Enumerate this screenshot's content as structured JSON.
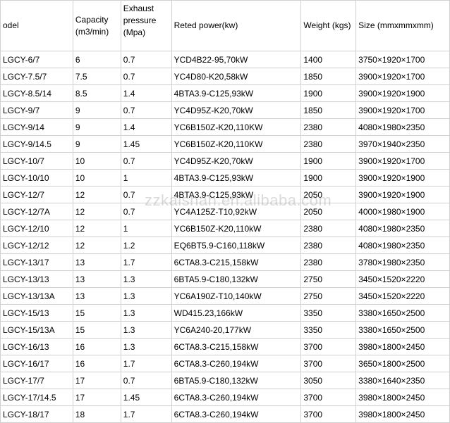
{
  "headers": {
    "model": "odel",
    "capacity": "Capacity (m3/min)",
    "exhaust": "Exhaust pressure (Mpa)",
    "power": "Reted power(kw)",
    "weight": "Weight (kgs)",
    "size": "Size (mmxmmxmm)"
  },
  "rows": [
    {
      "model": "LGCY-6/7",
      "capacity": "6",
      "exhaust": "0.7",
      "power": "YCD4B22-95,70kW",
      "weight": "1400",
      "size": "3750×1920×1700"
    },
    {
      "model": "LGCY-7.5/7",
      "capacity": "7.5",
      "exhaust": "0.7",
      "power": "YC4D80-K20,58kW",
      "weight": "1850",
      "size": "3900×1920×1700"
    },
    {
      "model": "LGCY-8.5/14",
      "capacity": "8.5",
      "exhaust": "1.4",
      "power": "4BTA3.9-C125,93kW",
      "weight": "1900",
      "size": "3900×1920×1900"
    },
    {
      "model": "LGCY-9/7",
      "capacity": "9",
      "exhaust": "0.7",
      "power": "YC4D95Z-K20,70kW",
      "weight": "1850",
      "size": "3900×1920×1700"
    },
    {
      "model": "LGCY-9/14",
      "capacity": "9",
      "exhaust": "1.4",
      "power": "YC6B150Z-K20,110KW",
      "weight": "2380",
      "size": "4080×1980×2350"
    },
    {
      "model": "LGCY-9/14.5",
      "capacity": "9",
      "exhaust": "1.45",
      "power": "YC6B150Z-K20,110KW",
      "weight": "2380",
      "size": "3970×1940×2350"
    },
    {
      "model": "LGCY-10/7",
      "capacity": "10",
      "exhaust": "0.7",
      "power": "YC4D95Z-K20,70kW",
      "weight": "1900",
      "size": "3900×1920×1700"
    },
    {
      "model": "LGCY-10/10",
      "capacity": "10",
      "exhaust": "1",
      "power": "4BTA3.9-C125,93kW",
      "weight": "1900",
      "size": "3900×1920×1900"
    },
    {
      "model": "LGCY-12/7",
      "capacity": "12",
      "exhaust": "0.7",
      "power": "4BTA3.9-C125,93kW",
      "weight": "2050",
      "size": "3900×1920×1900"
    },
    {
      "model": "LGCY-12/7A",
      "capacity": "12",
      "exhaust": "0.7",
      "power": "YC4A125Z-T10,92kW",
      "weight": "2050",
      "size": "4000×1980×1900"
    },
    {
      "model": "LGCY-12/10",
      "capacity": "12",
      "exhaust": "1",
      "power": "YC6B150Z-K20,110kW",
      "weight": "2380",
      "size": "4080×1980×2350"
    },
    {
      "model": "LGCY-12/12",
      "capacity": "12",
      "exhaust": "1.2",
      "power": "EQ6BT5.9-C160,118kW",
      "weight": "2380",
      "size": "4080×1980×2350"
    },
    {
      "model": "LGCY-13/17",
      "capacity": "13",
      "exhaust": "1.7",
      "power": "6CTA8.3-C215,158kW",
      "weight": "2380",
      "size": "3780×1980×2350"
    },
    {
      "model": "LGCY-13/13",
      "capacity": "13",
      "exhaust": "1.3",
      "power": "6BTA5.9-C180,132kW",
      "weight": "2750",
      "size": "3450×1520×2220"
    },
    {
      "model": "LGCY-13/13A",
      "capacity": "13",
      "exhaust": "1.3",
      "power": "YC6A190Z-T10,140kW",
      "weight": "2750",
      "size": "3450×1520×2220"
    },
    {
      "model": "LGCY-15/13",
      "capacity": "15",
      "exhaust": "1.3",
      "power": "WD415.23,166kW",
      "weight": "3350",
      "size": "3380×1650×2500"
    },
    {
      "model": "LGCY-15/13A",
      "capacity": "15",
      "exhaust": "1.3",
      "power": "YC6A240-20,177kW",
      "weight": "3350",
      "size": "3380×1650×2500"
    },
    {
      "model": "LGCY-16/13",
      "capacity": "16",
      "exhaust": "1.3",
      "power": "6CTA8.3-C215,158kW",
      "weight": "3700",
      "size": "3980×1800×2450"
    },
    {
      "model": "LGCY-16/17",
      "capacity": "16",
      "exhaust": "1.7",
      "power": "6CTA8.3-C260,194kW",
      "weight": "3700",
      "size": "3650×1800×2500"
    },
    {
      "model": "LGCY-17/7",
      "capacity": "17",
      "exhaust": "0.7",
      "power": "6BTA5.9-C180,132kW",
      "weight": "3050",
      "size": "3380×1640×2350"
    },
    {
      "model": "LGCY-17/14.5",
      "capacity": "17",
      "exhaust": "1.45",
      "power": "6CTA8.3-C260,194kW",
      "weight": "3700",
      "size": "3980×1800×2450"
    },
    {
      "model": "LGCY-18/17",
      "capacity": "18",
      "exhaust": "1.7",
      "power": "6CTA8.3-C260,194kW",
      "weight": "3700",
      "size": "3980×1800×2450"
    }
  ],
  "watermark": "zzkaishan.en.alibaba.com"
}
